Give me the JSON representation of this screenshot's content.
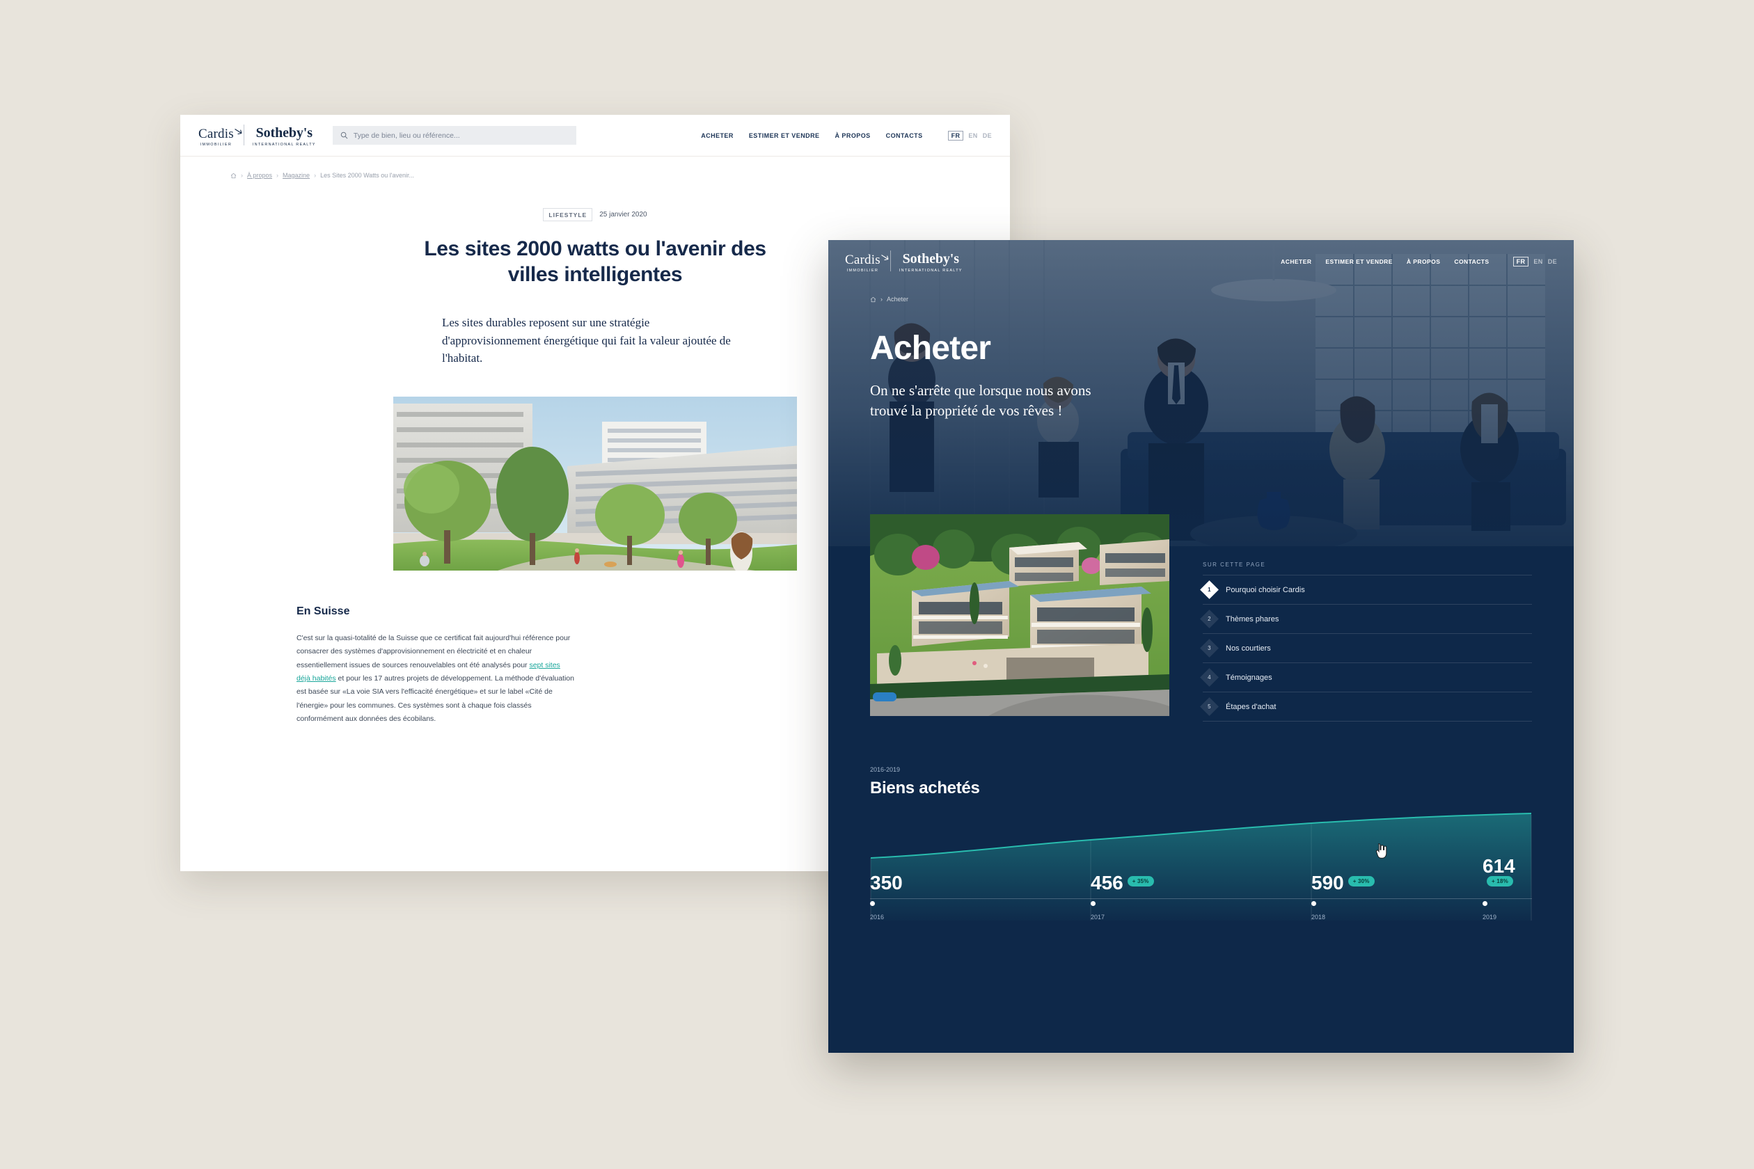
{
  "brand": {
    "cardis_name": "Cardis",
    "cardis_sub": "IMMOBILIER",
    "sothebys_name": "Sotheby's",
    "sothebys_sub": "INTERNATIONAL REALTY",
    "navy": "#0e2849",
    "teal": "#29bcae",
    "page_background": "#e8e4dc"
  },
  "window_article": {
    "search": {
      "value": "",
      "placeholder": "Type de bien, lieu ou référence..."
    },
    "nav": [
      {
        "label": "ACHETER"
      },
      {
        "label": "ESTIMER ET VENDRE"
      },
      {
        "label": "À PROPOS"
      },
      {
        "label": "CONTACTS"
      }
    ],
    "languages": [
      {
        "code": "FR",
        "active": true
      },
      {
        "code": "EN",
        "active": false
      },
      {
        "code": "DE",
        "active": false
      }
    ],
    "breadcrumb": {
      "home_icon": "home-icon",
      "items": [
        "À propos",
        "Magazine",
        "Les Sites 2000 Watts ou l'avenir..."
      ],
      "separator": "›"
    },
    "article": {
      "category": "LIFESTYLE",
      "date": "25 janvier 2020",
      "title": "Les sites 2000 watts ou l'avenir des villes intelligentes",
      "lead": "Les sites durables reposent sur une stratégie d'approvisionnement énergétique qui fait la valeur ajoutée de l'habitat.",
      "image_caption": "Vue de cour intérieure d'un quartier résidentiel avec arbres et pelouse",
      "section_heading": "En Suisse",
      "body_before_link": "C'est sur la quasi-totalité de la Suisse que ce certificat fait aujourd'hui référence pour consacrer des systèmes d'approvisionnement en électricité et en chaleur essentiellement issues de sources renouvelables ont été analysés pour ",
      "body_link": "sept sites déjà habités",
      "body_after_link": " et pour les 17 autres projets de développement. La méthode d'évaluation est basée sur «La voie SIA vers l'efficacité énergétique» et sur le label «Cité de l'énergie» pour les communes. Ces systèmes sont à chaque fois classés conformément aux données des écobilans."
    }
  },
  "window_acheter": {
    "nav": [
      {
        "label": "ACHETER"
      },
      {
        "label": "ESTIMER ET VENDRE"
      },
      {
        "label": "À PROPOS"
      },
      {
        "label": "CONTACTS"
      }
    ],
    "languages": [
      {
        "code": "FR",
        "active": true
      },
      {
        "code": "EN",
        "active": false
      },
      {
        "code": "DE",
        "active": false
      }
    ],
    "breadcrumb": {
      "home_icon": "home-icon",
      "items": [
        "Acheter"
      ],
      "separator": "›"
    },
    "hero": {
      "title": "Acheter",
      "subtitle": "On ne s'arrête que lorsque nous avons trouvé la propriété de vos rêves !",
      "image_caption": "Équipe de courtiers Cardis assise dans un salon"
    },
    "property_image_caption": "Vue aérienne d'une résidence contemporaine en terrasses avec jardins",
    "on_this_page": {
      "label": "SUR CETTE PAGE",
      "items": [
        {
          "number": "1",
          "label": "Pourquoi choisir Cardis",
          "active": true
        },
        {
          "number": "2",
          "label": "Thèmes phares",
          "active": false
        },
        {
          "number": "3",
          "label": "Nos courtiers",
          "active": false
        },
        {
          "number": "4",
          "label": "Témoignages",
          "active": false
        },
        {
          "number": "5",
          "label": "Étapes d'achat",
          "active": false
        }
      ]
    },
    "chart_data": {
      "type": "area",
      "title": "Biens achetés",
      "subtitle": "2016-2019",
      "xlabel": "",
      "ylabel": "",
      "categories": [
        "2016",
        "2017",
        "2018",
        "2019"
      ],
      "values": [
        350,
        456,
        590,
        614
      ],
      "value_labels": [
        "350",
        "456",
        "590",
        "614"
      ],
      "growth_labels": [
        "",
        "+ 35%",
        "+ 30%",
        "+ 18%"
      ],
      "ylim": [
        0,
        700
      ],
      "grid": false,
      "legend": "none",
      "line_color": "#29bcae",
      "fill_gradient": [
        "rgba(41,188,174,0.45)",
        "rgba(41,188,174,0.02)"
      ]
    }
  },
  "cursor": {
    "name": "pointer-hand-cursor"
  }
}
